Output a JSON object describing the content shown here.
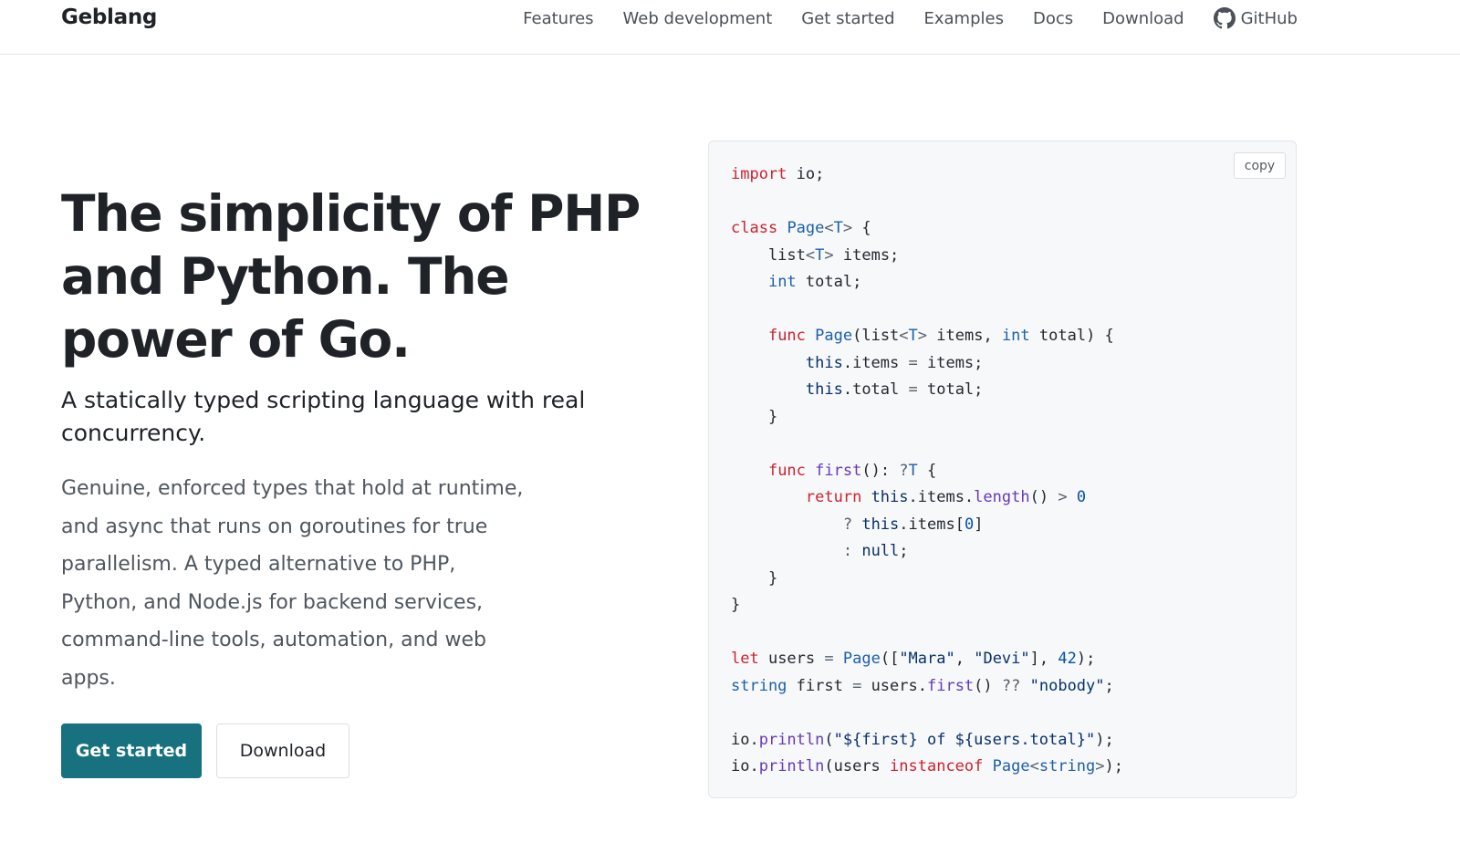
{
  "header": {
    "brand": "Geblang",
    "nav": [
      {
        "label": "Features"
      },
      {
        "label": "Web development"
      },
      {
        "label": "Get started"
      },
      {
        "label": "Examples"
      },
      {
        "label": "Docs"
      },
      {
        "label": "Download"
      },
      {
        "label": "GitHub",
        "icon": "github-icon"
      }
    ]
  },
  "hero": {
    "title": "The simplicity of PHP and Python. The power of Go.",
    "subtitle": "A statically typed scripting language with real concurrency.",
    "description": "Genuine, enforced types that hold at runtime, and async that runs on goroutines for true parallelism. A typed alternative to PHP, Python, and Node.js for backend services, command-line tools, automation, and web apps.",
    "primary_button": "Get started",
    "secondary_button": "Download"
  },
  "code": {
    "copy_label": "copy",
    "lines": [
      [
        [
          "kw",
          "import"
        ],
        [
          "p",
          " io;"
        ]
      ],
      [],
      [
        [
          "kw",
          "class"
        ],
        [
          "p",
          " "
        ],
        [
          "ty2",
          "Page"
        ],
        [
          "op",
          "<"
        ],
        [
          "ty2",
          "T"
        ],
        [
          "op",
          ">"
        ],
        [
          "p",
          " {"
        ]
      ],
      [
        [
          "p",
          "    list"
        ],
        [
          "op",
          "<"
        ],
        [
          "ty2",
          "T"
        ],
        [
          "op",
          ">"
        ],
        [
          "p",
          " items;"
        ]
      ],
      [
        [
          "p",
          "    "
        ],
        [
          "ty2",
          "int"
        ],
        [
          "p",
          " total;"
        ]
      ],
      [],
      [
        [
          "p",
          "    "
        ],
        [
          "kw",
          "func"
        ],
        [
          "p",
          " "
        ],
        [
          "ty2",
          "Page"
        ],
        [
          "p",
          "(list"
        ],
        [
          "op",
          "<"
        ],
        [
          "ty2",
          "T"
        ],
        [
          "op",
          ">"
        ],
        [
          "p",
          " items, "
        ],
        [
          "ty2",
          "int"
        ],
        [
          "p",
          " total) {"
        ]
      ],
      [
        [
          "p",
          "        "
        ],
        [
          "ty",
          "this"
        ],
        [
          "p",
          ".items "
        ],
        [
          "op",
          "="
        ],
        [
          "p",
          " items;"
        ]
      ],
      [
        [
          "p",
          "        "
        ],
        [
          "ty",
          "this"
        ],
        [
          "p",
          ".total "
        ],
        [
          "op",
          "="
        ],
        [
          "p",
          " total;"
        ]
      ],
      [
        [
          "p",
          "    }"
        ]
      ],
      [],
      [
        [
          "p",
          "    "
        ],
        [
          "kw",
          "func"
        ],
        [
          "p",
          " "
        ],
        [
          "fn",
          "first"
        ],
        [
          "p",
          "(): "
        ],
        [
          "op",
          "?"
        ],
        [
          "ty2",
          "T"
        ],
        [
          "p",
          " {"
        ]
      ],
      [
        [
          "p",
          "        "
        ],
        [
          "kw",
          "return"
        ],
        [
          "p",
          " "
        ],
        [
          "ty",
          "this"
        ],
        [
          "p",
          ".items."
        ],
        [
          "fn",
          "length"
        ],
        [
          "p",
          "() "
        ],
        [
          "op",
          ">"
        ],
        [
          "p",
          " "
        ],
        [
          "num",
          "0"
        ]
      ],
      [
        [
          "p",
          "            "
        ],
        [
          "op",
          "?"
        ],
        [
          "p",
          " "
        ],
        [
          "ty",
          "this"
        ],
        [
          "p",
          ".items["
        ],
        [
          "num",
          "0"
        ],
        [
          "p",
          "]"
        ]
      ],
      [
        [
          "p",
          "            "
        ],
        [
          "op",
          ":"
        ],
        [
          "p",
          " "
        ],
        [
          "ty",
          "null"
        ],
        [
          "p",
          ";"
        ]
      ],
      [
        [
          "p",
          "    }"
        ]
      ],
      [
        [
          "p",
          "}"
        ]
      ],
      [],
      [
        [
          "kw",
          "let"
        ],
        [
          "p",
          " users "
        ],
        [
          "op",
          "="
        ],
        [
          "p",
          " "
        ],
        [
          "ty2",
          "Page"
        ],
        [
          "p",
          "(["
        ],
        [
          "str",
          "\"Mara\""
        ],
        [
          "p",
          ", "
        ],
        [
          "str",
          "\"Devi\""
        ],
        [
          "p",
          "], "
        ],
        [
          "num",
          "42"
        ],
        [
          "p",
          ");"
        ]
      ],
      [
        [
          "ty2",
          "string"
        ],
        [
          "p",
          " first "
        ],
        [
          "op",
          "="
        ],
        [
          "p",
          " users."
        ],
        [
          "fn",
          "first"
        ],
        [
          "p",
          "() "
        ],
        [
          "op",
          "??"
        ],
        [
          "p",
          " "
        ],
        [
          "str",
          "\"nobody\""
        ],
        [
          "p",
          ";"
        ]
      ],
      [],
      [
        [
          "p",
          "io."
        ],
        [
          "fn",
          "println"
        ],
        [
          "p",
          "("
        ],
        [
          "str",
          "\"${first} of ${users.total}\""
        ],
        [
          "p",
          ");"
        ]
      ],
      [
        [
          "p",
          "io."
        ],
        [
          "fn",
          "println"
        ],
        [
          "p",
          "(users "
        ],
        [
          "kw",
          "instanceof"
        ],
        [
          "p",
          " "
        ],
        [
          "ty2",
          "Page"
        ],
        [
          "op",
          "<"
        ],
        [
          "ty2",
          "string"
        ],
        [
          "op",
          ">"
        ],
        [
          "p",
          ");"
        ]
      ]
    ]
  },
  "colors": {
    "accent": "#17717e",
    "code_bg": "#f6f8fa"
  }
}
